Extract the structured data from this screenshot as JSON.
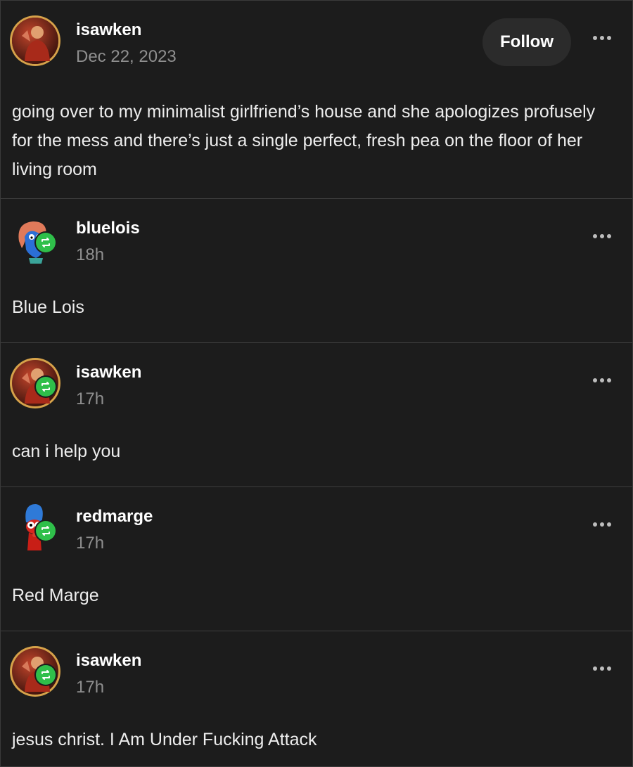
{
  "original_post": {
    "username": "isawken",
    "date": "Dec 22, 2023",
    "follow_label": "Follow",
    "text": "going over to my minimalist girlfriend’s house and she apologizes profusely for the mess and there’s just a single perfect, fresh pea on the floor of her living room",
    "avatar_icon": "portrait-avatar-icon"
  },
  "reblogs": [
    {
      "username": "bluelois",
      "time": "18h",
      "text": "Blue Lois",
      "avatar_icon": "blue-lois-avatar-icon"
    },
    {
      "username": "isawken",
      "time": "17h",
      "text": "can i help you",
      "avatar_icon": "portrait-avatar-icon"
    },
    {
      "username": "redmarge",
      "time": "17h",
      "text": "Red Marge",
      "avatar_icon": "red-marge-avatar-icon"
    },
    {
      "username": "isawken",
      "time": "17h",
      "text": "jesus christ. I Am Under Fucking Attack",
      "avatar_icon": "portrait-avatar-icon"
    }
  ],
  "colors": {
    "background": "#1c1c1c",
    "reblog_badge": "#2fbf4a",
    "divider": "#3e3e3e"
  }
}
